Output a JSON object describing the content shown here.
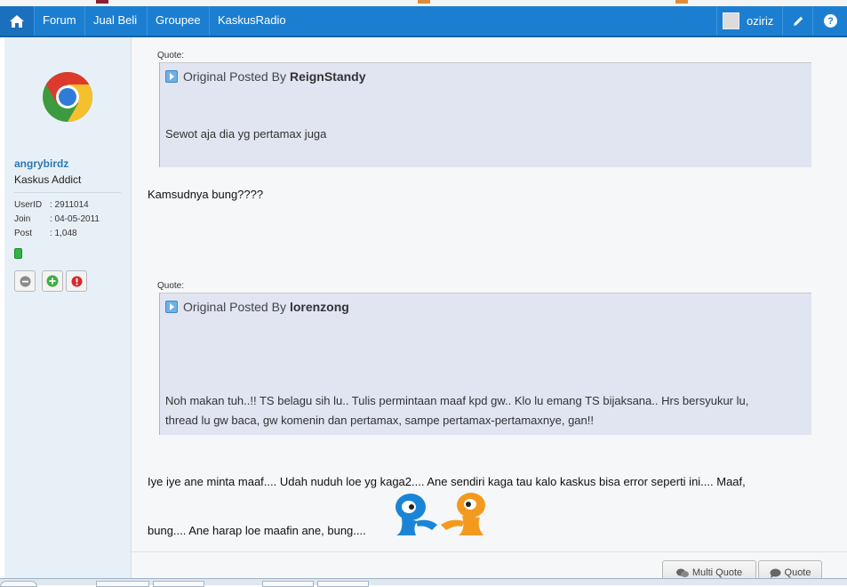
{
  "nav": {
    "items": [
      "Forum",
      "Jual Beli",
      "Groupee",
      "KaskusRadio"
    ],
    "username": "oziriz",
    "help": "?"
  },
  "user": {
    "name": "angrybirdz",
    "rank": "Kaskus Addict",
    "stats": [
      {
        "label": "UserID",
        "value": ": 2911014"
      },
      {
        "label": "Join",
        "value": ": 04-05-2011"
      },
      {
        "label": "Post",
        "value": ": 1,048"
      }
    ]
  },
  "post": {
    "quote_label": "Quote:",
    "quotes": [
      {
        "prefix": "Original Posted By",
        "author": "ReignStandy",
        "lines": [
          "Sewot aja dia yg pertamax juga"
        ]
      },
      {
        "prefix": "Original Posted By",
        "author": "lorenzong",
        "lines": [
          "Noh makan tuh..!! TS belagu sih lu.. Tulis permintaan maaf kpd gw.. Klo lu emang TS bijaksana.. Hrs bersyukur lu,",
          "thread lu gw baca, gw komenin dan pertamax, sampe pertamax-pertamaxnye, gan!!"
        ]
      }
    ],
    "reply_1": "Kamsudnya bung????",
    "reply_2_line1": "Iye iye ane minta maaf.... Udah nuduh loe yg kaga2.... Ane sendiri kaga tau kalo kaskus bisa error seperti ini.... Maaf,",
    "reply_2_line2": "bung.... Ane harap loe maafin ane, bung...."
  },
  "buttons": {
    "multi_quote": "Multi Quote",
    "quote": "Quote"
  },
  "colors": {
    "navbar": "#1c7ed0",
    "sidebar": "#e8f0f7",
    "quote_bg": "#e1e5f1",
    "username": "#2c77b5",
    "online": "#2fb445"
  }
}
